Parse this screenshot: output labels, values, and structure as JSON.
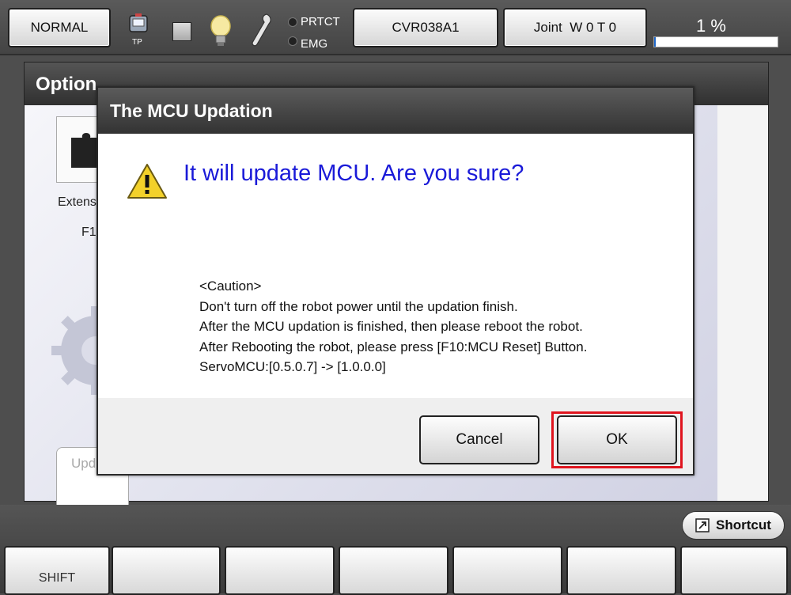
{
  "topbar": {
    "mode_label": "NORMAL",
    "tp_icon_label": "TP",
    "lamps": [
      {
        "label": "PRTCT"
      },
      {
        "label": "EMG"
      }
    ],
    "robot_name": "CVR038A1",
    "coord_label": "Joint  W 0 T 0",
    "speed_text": "1 %",
    "speed_value": 1
  },
  "background_window": {
    "title": "Option",
    "extension_text": "Extens",
    "fkey_text": "F1",
    "input_placeholder": "Upd"
  },
  "dialog": {
    "title": "The MCU Updation",
    "question": "It will update MCU. Are you sure?",
    "caution_lines": [
      "<Caution>",
      "Don't turn off the robot power until the updation finish.",
      "After the MCU updation is finished, then please reboot the robot.",
      "After Rebooting the robot, please press [F10:MCU Reset] Button.",
      "ServoMCU:[0.5.0.7] -> [1.0.0.0]"
    ],
    "cancel_label": "Cancel",
    "ok_label": "OK",
    "question_color": "#1a1ad8",
    "highlight_color": "#e0141e"
  },
  "bottombar": {
    "shortcut_label": "Shortcut",
    "fkeys": [
      "SHIFT",
      "",
      "",
      "",
      "",
      "",
      "",
      ""
    ]
  }
}
